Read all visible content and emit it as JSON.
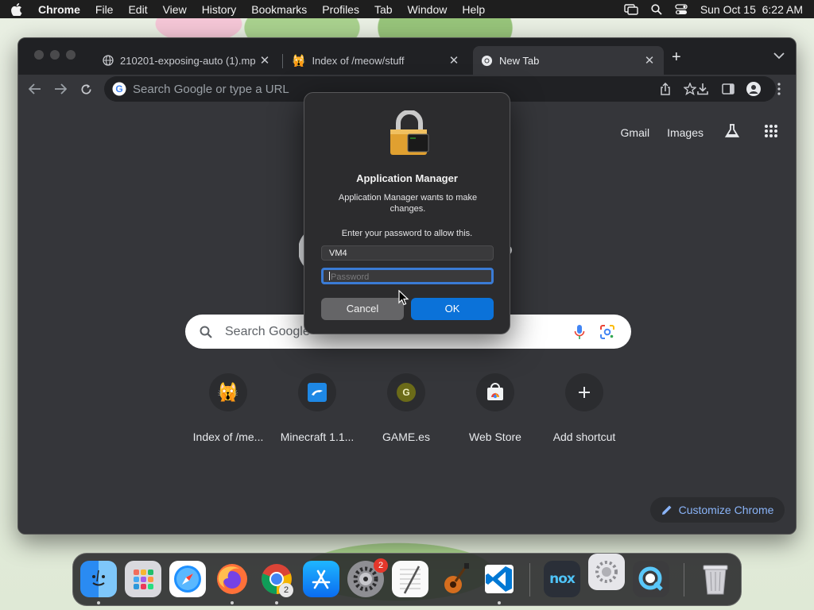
{
  "menubar": {
    "app_name": "Chrome",
    "menus": [
      "File",
      "Edit",
      "View",
      "History",
      "Bookmarks",
      "Profiles",
      "Tab",
      "Window",
      "Help"
    ],
    "clock": "Sun Oct 15  6:22 AM"
  },
  "browser": {
    "tabs": [
      {
        "title": "210201-exposing-auto (1).mp",
        "icon": "globe-icon",
        "active": false
      },
      {
        "title": "Index of /meow/stuff",
        "icon": "cat-emoji-icon",
        "active": false
      },
      {
        "title": "New Tab",
        "icon": "chrome-icon",
        "active": true
      }
    ],
    "omnibox_placeholder": "Search Google or type a URL",
    "top_links": {
      "gmail": "Gmail",
      "images": "Images"
    },
    "search_placeholder": "Search Google",
    "shortcuts": [
      {
        "label": "Index of /me...",
        "icon": "cat-emoji-icon"
      },
      {
        "label": "Minecraft 1.1...",
        "icon": "minecraft-icon"
      },
      {
        "label": "GAME.es",
        "icon": "letter-g-icon",
        "letter": "G"
      },
      {
        "label": "Web Store",
        "icon": "webstore-icon"
      },
      {
        "label": "Add shortcut",
        "icon": "plus-icon"
      }
    ],
    "customize_label": "Customize Chrome"
  },
  "dialog": {
    "title": "Application Manager",
    "message": "Application Manager wants to make changes.",
    "prompt": "Enter your password to allow this.",
    "username": "VM4",
    "password_placeholder": "Password",
    "cancel_label": "Cancel",
    "ok_label": "OK"
  },
  "dock": {
    "system_settings_badge": "2",
    "chrome_badge": "2",
    "nox_label": "nox"
  },
  "colors": {
    "accent_blue": "#0b72d9",
    "link_blue": "#8ab4f8",
    "badge_red": "#e5372b"
  }
}
